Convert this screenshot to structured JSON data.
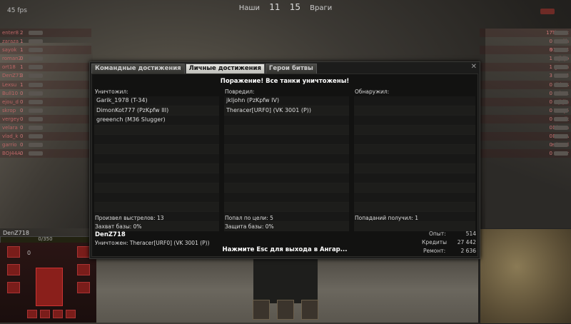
{
  "hud": {
    "fps": "45 fps",
    "ally_label": "Наши",
    "ally_count": "11",
    "enemy_count": "15",
    "enemy_label": "Враги"
  },
  "left_team": [
    {
      "name": "enter8",
      "tier": "2"
    },
    {
      "name": "zaraza",
      "tier": "1"
    },
    {
      "name": "sayok",
      "tier": "1"
    },
    {
      "name": "roman2",
      "tier": "0"
    },
    {
      "name": "ort18",
      "tier": "1"
    },
    {
      "name": "DenZ71",
      "tier": "3"
    },
    {
      "name": "Lexsu",
      "tier": "1"
    },
    {
      "name": "Bull10",
      "tier": "0"
    },
    {
      "name": "ejou_d",
      "tier": "0"
    },
    {
      "name": "skrop",
      "tier": "0"
    },
    {
      "name": "vergey",
      "tier": "0"
    },
    {
      "name": "velara",
      "tier": "0"
    },
    {
      "name": "vlad_k",
      "tier": "0"
    },
    {
      "name": "garrio",
      "tier": "0"
    },
    {
      "name": "BOJ44A",
      "tier": "0"
    }
  ],
  "right_team": [
    {
      "name": "Therac",
      "tier": "17"
    },
    {
      "name": "Trollh",
      "tier": "0"
    },
    {
      "name": "937383",
      "tier": "0"
    },
    {
      "name": "jkljo",
      "tier": "1"
    },
    {
      "name": "green",
      "tier": "1"
    },
    {
      "name": "e1Zr3",
      "tier": "3"
    },
    {
      "name": "dhhos",
      "tier": "0"
    },
    {
      "name": "tuba1",
      "tier": "0"
    },
    {
      "name": "jkjin",
      "tier": "0"
    },
    {
      "name": "ZZRJ6",
      "tier": "0"
    },
    {
      "name": "Garik",
      "tier": "0"
    },
    {
      "name": "Dimon",
      "tier": "0"
    },
    {
      "name": "BoKKA",
      "tier": "0"
    },
    {
      "name": "eduard",
      "tier": "0"
    },
    {
      "name": "verrar",
      "tier": "0"
    }
  ],
  "player_panel": {
    "name": "DenZ718",
    "hp": "0/350",
    "speed": "0"
  },
  "dialog": {
    "tabs": [
      "Командные достижения",
      "Личные достижения",
      "Герои битвы"
    ],
    "active_tab": 1,
    "close": "✕",
    "title": "Поражение! Все танки уничтожены!",
    "columns": [
      {
        "header": "Уничтожил:",
        "items": [
          "Garik_1978 (T-34)",
          "DimonKot777 (PzKpfw III)",
          "greeench (M36 Slugger)"
        ]
      },
      {
        "header": "Повредил:",
        "items": [
          "jkljohn (PzKpfw IV)",
          "Theracer[URF0] (VK 3001 (P))"
        ]
      },
      {
        "header": "Обнаружил:",
        "items": []
      }
    ],
    "stats": {
      "shots_label": "Произвел выстрелов: 13",
      "capture_label": "Захват базы: 0%",
      "hits_label": "Попал по цели: 5",
      "defense_label": "Защита базы: 0%",
      "received_label": "Попаданий получил: 1"
    },
    "player_name": "DenZ718",
    "killed_by": "Уничтожен: Theracer[URF0] (VK 3001 (P))",
    "rewards": [
      {
        "label": "Опыт:",
        "value": "514"
      },
      {
        "label": "Кредиты",
        "value": "27 442"
      },
      {
        "label": "Ремонт:",
        "value": "2 636"
      }
    ],
    "esc_hint": "Нажмите Esc для выхода в Ангар..."
  }
}
